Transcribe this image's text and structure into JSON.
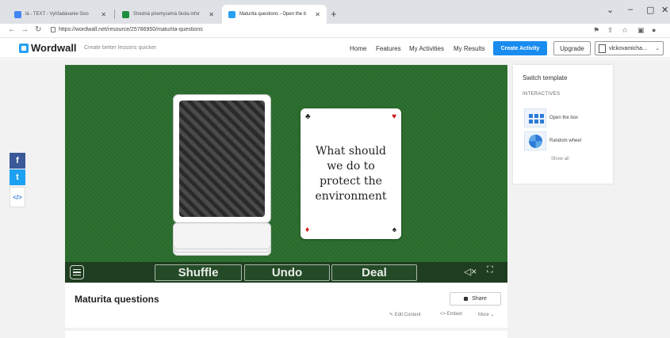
{
  "browser": {
    "tabs": [
      {
        "title": "lá - TEXT - Vyhľadávanie Goo",
        "favicon_color": "#4285f4",
        "active": false
      },
      {
        "title": "Stredná priemyselná škola infor",
        "favicon_color": "#1e8e3e",
        "active": false
      },
      {
        "title": "Maturita questions - Open the b",
        "favicon_color": "#27a1f0",
        "active": true
      }
    ],
    "new_tab": "+",
    "url": "https://wordwall.net/resource/25786950/maturita-questions",
    "window_controls": [
      "⌄",
      "–",
      "▢",
      "✕"
    ]
  },
  "header": {
    "logo": "Wordwall",
    "tagline": "Create better lessons quicker",
    "nav": [
      "Home",
      "Features",
      "My Activities",
      "My Results"
    ],
    "create_activity": "Create Activity",
    "upgrade": "Upgrade",
    "user": "vlckovamicha..."
  },
  "social": {
    "facebook": "f",
    "twitter": "t",
    "embed": "</>"
  },
  "game": {
    "card_text": "What should we do to protect the environment",
    "suits": {
      "top_left": "♣",
      "top_right": "♥",
      "bottom_left": "♦",
      "bottom_right": "♠"
    },
    "buttons": {
      "shuffle": "Shuffle",
      "undo": "Undo",
      "deal": "Deal"
    },
    "mute_icon": "◁×",
    "fullscreen_icon": "⛶"
  },
  "right_panel": {
    "title": "Switch template",
    "subtitle": "INTERACTIVES",
    "templates": [
      "Open the box",
      "Random wheel"
    ],
    "show_all": "Show all"
  },
  "info": {
    "title": "Maturita questions",
    "share": "Share",
    "edit_content": "✎ Edit Content",
    "embed": "<> Embed",
    "more": "More ⌄"
  }
}
